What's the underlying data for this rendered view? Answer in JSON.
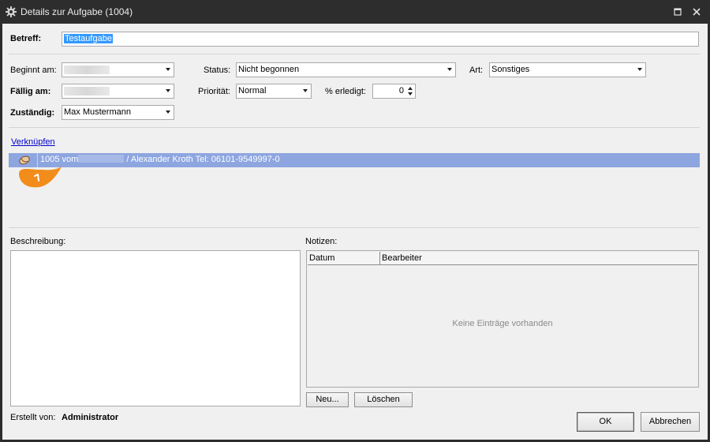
{
  "window": {
    "title": "Details zur Aufgabe (1004)"
  },
  "form": {
    "subject_label": "Betreff:",
    "subject_value": "Testaufgabe",
    "begins_label": "Beginnt am:",
    "due_label": "Fällig am:",
    "assignee_label": "Zuständig:",
    "assignee_value": "Max Mustermann",
    "status_label": "Status:",
    "status_value": "Nicht begonnen",
    "priority_label": "Priorität:",
    "priority_value": "Normal",
    "done_label": "% erledigt:",
    "done_value": "0",
    "type_label": "Art:",
    "type_value": "Sonstiges"
  },
  "links": {
    "title": "Verknüpfen",
    "row": {
      "prefix": "1005 vom",
      "suffix": " / Alexander Kroth Tel: 06101-9549997-0"
    },
    "marker_number": "1"
  },
  "description": {
    "label": "Beschreibung:"
  },
  "notes": {
    "label": "Notizen:",
    "columns": [
      "Datum",
      "Bearbeiter"
    ],
    "empty_text": "Keine Einträge vorhanden",
    "new_label": "Neu...",
    "delete_label": "Löschen"
  },
  "footer": {
    "created_label": "Erstellt von:",
    "created_value": "Administrator",
    "ok_label": "OK",
    "cancel_label": "Abbrechen"
  },
  "colors": {
    "selection": "#3399ff",
    "link_row": "#8ea6e0",
    "marker": "#f28c1b"
  }
}
